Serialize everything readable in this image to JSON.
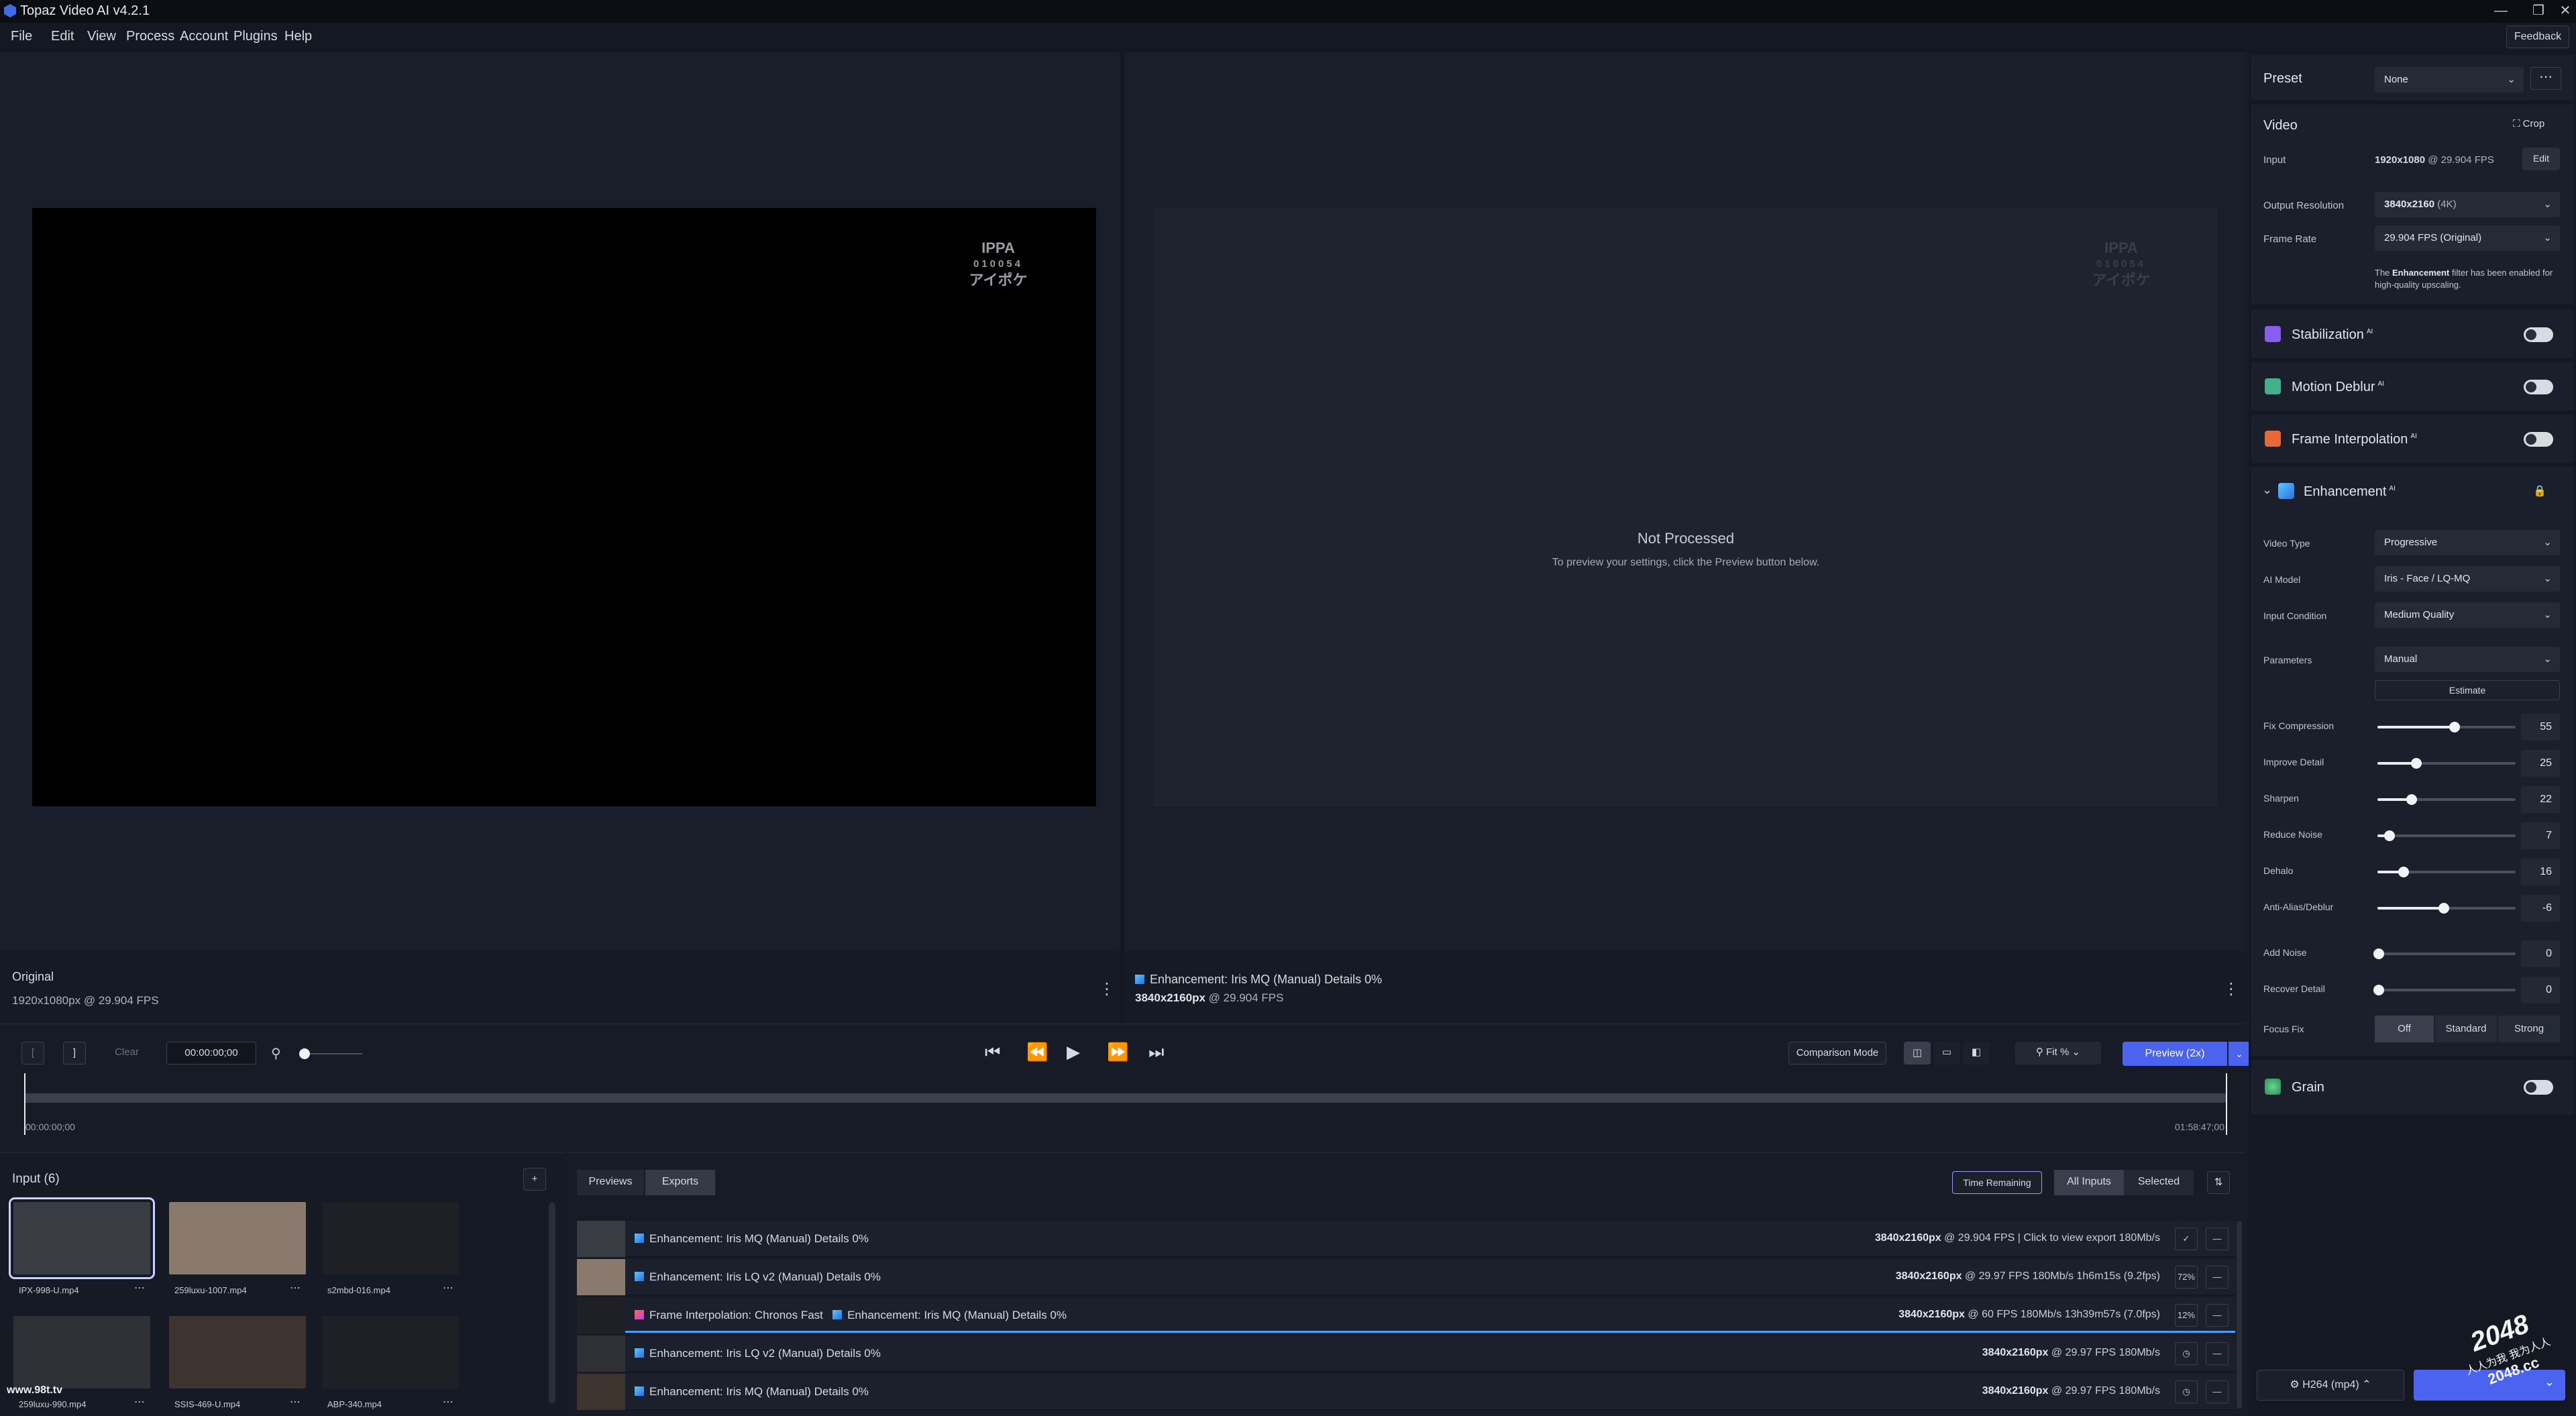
{
  "app": {
    "title": "Topaz Video AI  v4.2.1",
    "window_controls": [
      "—",
      "❐",
      "✕"
    ],
    "feedback_label": "Feedback"
  },
  "menu": [
    "File",
    "Edit",
    "View",
    "Process",
    "Account",
    "Plugins",
    "Help"
  ],
  "viewer": {
    "watermark_lines": [
      "IPPA",
      "010054",
      "アイポケ"
    ],
    "not_processed_title": "Not Processed",
    "not_processed_sub": "To preview your settings, click the Preview button below.",
    "left_info": {
      "title": "Original",
      "sub": "1920x1080px @ 29.904 FPS"
    },
    "right_info": {
      "title": "Enhancement: Iris MQ (Manual) Details 0%",
      "res": "3840x2160px",
      "sub": " @ 29.904 FPS"
    }
  },
  "controls": {
    "bracket_open": "[",
    "bracket_close": "]",
    "clear_label": "Clear",
    "timecode": "00:00:00;00",
    "comparison_label": "Comparison Mode",
    "zoom_label": "Fit %",
    "preview_label": "Preview (2x)",
    "time_start": "00:00:00;00",
    "time_end": "01:58:47;00"
  },
  "input_panel": {
    "title": "Input (6)",
    "add_label": "+",
    "files": [
      {
        "name": "IPX-998-U.mp4",
        "tone": "#3a3c44"
      },
      {
        "name": "259luxu-1007.mp4",
        "tone": "#8a7a6e"
      },
      {
        "name": "s2mbd-016.mp4",
        "tone": "#1e2026"
      },
      {
        "name": "259luxu-990.mp4",
        "tone": "#2f3036"
      },
      {
        "name": "SSIS-469-U.mp4",
        "tone": "#3d3430"
      },
      {
        "name": "ABP-340.mp4",
        "tone": "#1e2026"
      }
    ],
    "watermark_site": "www.98t.tv"
  },
  "exports_panel": {
    "tabs": [
      "Previews",
      "Exports"
    ],
    "time_remaining_label": "Time Remaining",
    "filter_tabs": [
      "All Inputs",
      "Selected"
    ],
    "rows": [
      {
        "prefix": "",
        "label": "Enhancement: Iris MQ (Manual) Details 0%",
        "res": "3840x2160px",
        "fps": " @ 29.904 FPS",
        "extra": "  |  Click to view export  180Mb/s",
        "badge": "✓",
        "thumb": "#3a3c44"
      },
      {
        "prefix": "",
        "label": "Enhancement: Iris LQ v2 (Manual) Details 0%",
        "res": "3840x2160px",
        "fps": " @ 29.97 FPS",
        "extra": "  180Mb/s    1h6m15s (9.2fps)",
        "badge": "72%",
        "thumb": "#8a7a6e"
      },
      {
        "prefix": "Frame Interpolation: Chronos Fast",
        "label": "Enhancement: Iris MQ (Manual) Details 0%",
        "res": "3840x2160px",
        "fps": " @ 60 FPS",
        "extra": "  180Mb/s    13h39m57s (7.0fps)",
        "badge": "12%",
        "thumb": "#1e2026"
      },
      {
        "prefix": "",
        "label": "Enhancement: Iris LQ v2 (Manual) Details 0%",
        "res": "3840x2160px",
        "fps": " @ 29.97 FPS",
        "extra": "  180Mb/s",
        "badge": "◷",
        "thumb": "#2f3036"
      },
      {
        "prefix": "",
        "label": "Enhancement: Iris MQ (Manual) Details 0%",
        "res": "3840x2160px",
        "fps": " @ 29.97 FPS",
        "extra": "  180Mb/s",
        "badge": "◷",
        "thumb": "#3d3430"
      }
    ]
  },
  "sidebar": {
    "preset_label": "Preset",
    "preset_value": "None",
    "video_label": "Video",
    "crop_label": "Crop",
    "input_label": "Input",
    "input_res": "1920x1080",
    "input_fps": " @ 29.904 FPS",
    "edit_label": "Edit",
    "output_res_label": "Output Resolution",
    "output_res_value": "3840x2160",
    "output_res_suffix": " (4K)",
    "frame_rate_label": "Frame Rate",
    "frame_rate_value": "29.904 FPS (Original)",
    "note_pre": "The ",
    "note_bold": "Enhancement",
    "note_post": " filter has been enabled for high-quality upscaling.",
    "features": [
      {
        "name": "Stabilization",
        "sup": "AI",
        "color": "#8a5cf0"
      },
      {
        "name": "Motion Deblur",
        "sup": "AI",
        "color": "#44b08a"
      },
      {
        "name": "Frame Interpolation",
        "sup": "AI",
        "color": "#e8683a"
      }
    ],
    "enhancement_label": "Enhancement",
    "enhancement_sup": "AI",
    "video_type_label": "Video Type",
    "video_type_value": "Progressive",
    "ai_model_label": "AI Model",
    "ai_model_value": "Iris - Face / LQ-MQ",
    "input_condition_label": "Input Condition",
    "input_condition_value": "Medium Quality",
    "parameters_label": "Parameters",
    "parameters_value": "Manual",
    "estimate_label": "Estimate",
    "sliders": [
      {
        "label": "Fix Compression",
        "value": "55",
        "frac": 0.55
      },
      {
        "label": "Improve Detail",
        "value": "25",
        "frac": 0.27
      },
      {
        "label": "Sharpen",
        "value": "22",
        "frac": 0.24
      },
      {
        "label": "Reduce Noise",
        "value": "7",
        "frac": 0.08
      },
      {
        "label": "Dehalo",
        "value": "16",
        "frac": 0.18
      },
      {
        "label": "Anti-Alias/Deblur",
        "value": "-6",
        "frac": 0.47
      },
      {
        "label": "Add Noise",
        "value": "0",
        "frac": 0.0
      },
      {
        "label": "Recover Detail",
        "value": "0",
        "frac": 0.0
      }
    ],
    "focus_fix_label": "Focus Fix",
    "focus_fix_options": [
      "Off",
      "Standard",
      "Strong"
    ],
    "grain_label": "Grain",
    "export_format": "H264 (mp4)"
  },
  "overlay_watermark": {
    "line1": "2048",
    "line2": "人人为我 我为人人",
    "line3": "2048.cc"
  }
}
